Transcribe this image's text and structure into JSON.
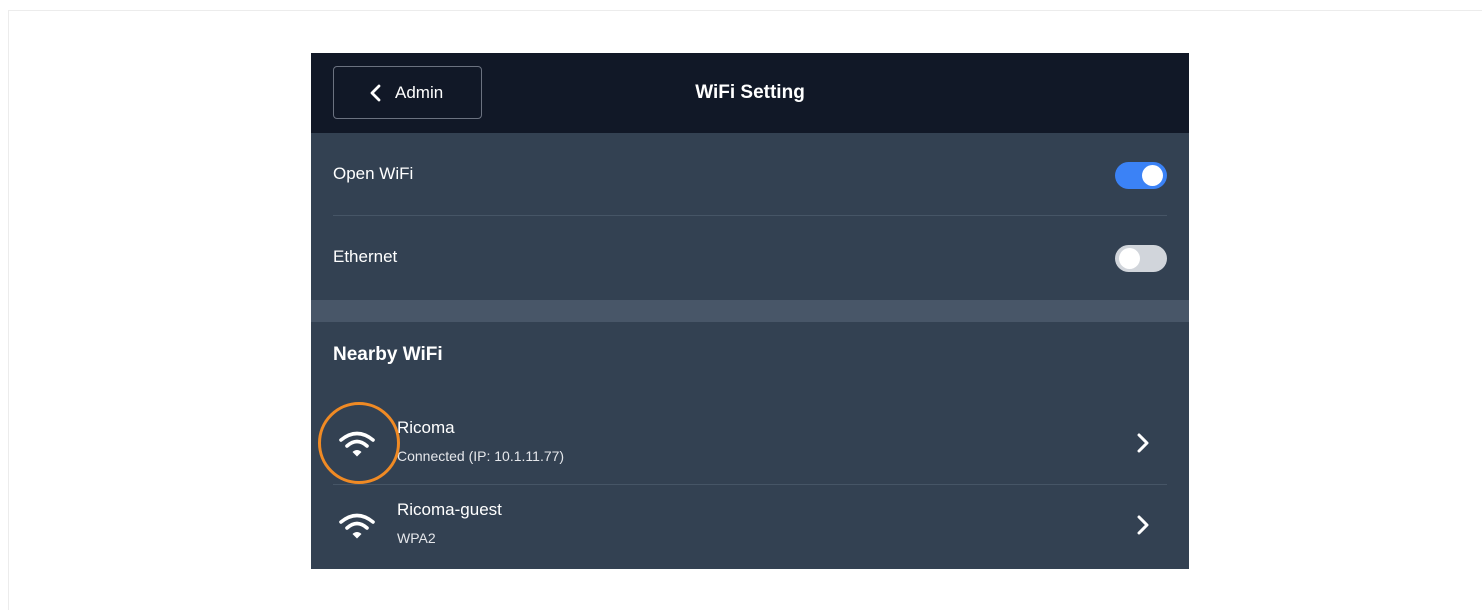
{
  "header": {
    "back_label": "Admin",
    "title": "WiFi Setting"
  },
  "settings": [
    {
      "label": "Open WiFi",
      "enabled": true
    },
    {
      "label": "Ethernet",
      "enabled": false
    }
  ],
  "nearby": {
    "title": "Nearby WiFi",
    "networks": [
      {
        "name": "Ricoma",
        "status": "Connected (IP: 10.1.11.77)",
        "icon": "wifi-icon"
      },
      {
        "name": "Ricoma-guest",
        "status": "WPA2",
        "icon": "wifi-icon"
      }
    ]
  },
  "colors": {
    "header_bg": "#111827",
    "panel_bg": "#334152",
    "toggle_on": "#3b82f6",
    "toggle_off": "#d1d5db",
    "highlight": "#f08a24"
  }
}
